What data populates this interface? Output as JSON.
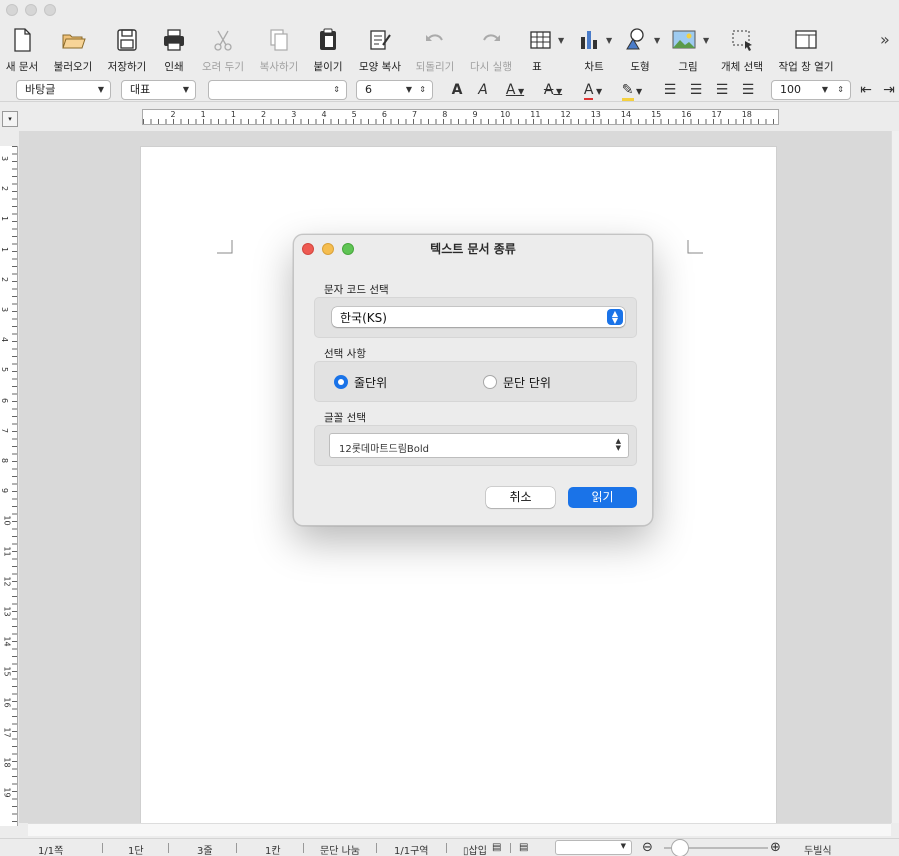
{
  "toolbar": {
    "items": [
      {
        "label": "새 문서",
        "icon": "new-document-icon",
        "enabled": true
      },
      {
        "label": "불러오기",
        "icon": "open-folder-icon",
        "enabled": true
      },
      {
        "label": "저장하기",
        "icon": "save-icon",
        "enabled": true
      },
      {
        "label": "인쇄",
        "icon": "print-icon",
        "enabled": true
      },
      {
        "label": "오려 두기",
        "icon": "cut-icon",
        "enabled": false
      },
      {
        "label": "복사하기",
        "icon": "copy-icon",
        "enabled": false
      },
      {
        "label": "붙이기",
        "icon": "paste-icon",
        "enabled": true
      },
      {
        "label": "모양 복사",
        "icon": "format-painter-icon",
        "enabled": true
      },
      {
        "label": "되돌리기",
        "icon": "undo-icon",
        "enabled": false
      },
      {
        "label": "다시 실행",
        "icon": "redo-icon",
        "enabled": false
      },
      {
        "label": "표",
        "icon": "table-icon",
        "enabled": true
      },
      {
        "label": "차트",
        "icon": "chart-icon",
        "enabled": true
      },
      {
        "label": "도형",
        "icon": "shapes-icon",
        "enabled": true
      },
      {
        "label": "그림",
        "icon": "picture-icon",
        "enabled": true
      },
      {
        "label": "개체 선택",
        "icon": "object-select-icon",
        "enabled": true
      },
      {
        "label": "작업 창 열기",
        "icon": "task-pane-icon",
        "enabled": true
      }
    ],
    "overflow_icon": "chevron-double-right-icon"
  },
  "format_bar": {
    "style": "바탕글",
    "font_lang": "대표",
    "font_name": "",
    "font_size": "6",
    "zoom": "100"
  },
  "ruler": {
    "h_numbers": [
      "2",
      "1",
      "1",
      "2",
      "3",
      "4",
      "5",
      "6",
      "7",
      "8",
      "9",
      "10",
      "11",
      "12",
      "13",
      "14",
      "15",
      "16",
      "17",
      "18"
    ],
    "v_numbers": [
      "3",
      "2",
      "1",
      "1",
      "2",
      "3",
      "4",
      "5",
      "6",
      "7",
      "8",
      "9",
      "10",
      "11",
      "12",
      "13",
      "14",
      "15",
      "16",
      "17",
      "18",
      "19"
    ]
  },
  "dialog": {
    "title": "텍스트 문서 종류",
    "encoding_label": "문자 코드 선택",
    "encoding_value": "한국(KS)",
    "options_label": "선택 사항",
    "option_line": "줄단위",
    "option_paragraph": "문단 단위",
    "selected_option": "line",
    "font_label": "글꼴 선택",
    "font_value": "12롯데마트드림Bold",
    "cancel": "취소",
    "ok": "읽기",
    "accent": "#1a73e8"
  },
  "status": {
    "page": "1/1쪽",
    "column": "1단",
    "line": "3줄",
    "col": "1칸",
    "para": "문단 나눔",
    "section": "1/1구역",
    "insert": "삽입",
    "view": "두빌식"
  }
}
